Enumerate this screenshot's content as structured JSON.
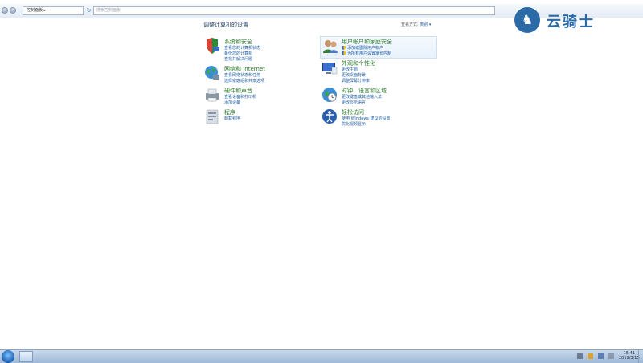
{
  "addressbar": {
    "path": "控制面板",
    "search_placeholder": "搜索控制面板"
  },
  "watermark": {
    "text": "云骑士"
  },
  "main": {
    "title": "调整计算机的设置",
    "view_by_label": "查看方式:",
    "view_by_value": "类别"
  },
  "categories_left": [
    {
      "title": "系统和安全",
      "links": [
        "查看您的计算机状态",
        "备份您的计算机",
        "查找并解决问题"
      ]
    },
    {
      "title": "网络和 Internet",
      "links": [
        "查看网络状态和任务",
        "选择家庭组和共享选项"
      ]
    },
    {
      "title": "硬件和声音",
      "links": [
        "查看设备和打印机",
        "添加设备"
      ]
    },
    {
      "title": "程序",
      "links": [
        "卸载程序"
      ]
    }
  ],
  "categories_right": [
    {
      "title": "用户帐户和家庭安全",
      "links": [
        "添加或删除用户帐户",
        "为所有用户设置家长控制"
      ]
    },
    {
      "title": "外观和个性化",
      "links": [
        "更改主题",
        "更改桌面背景",
        "调整屏幕分辨率"
      ]
    },
    {
      "title": "时钟、语言和区域",
      "links": [
        "更改键盘或其他输入法",
        "更改显示语言"
      ]
    },
    {
      "title": "轻松访问",
      "links": [
        "使用 Windows 建议的设置",
        "优化视频显示"
      ]
    }
  ],
  "taskbar": {
    "time": "15:41",
    "date": "2019/3/15"
  },
  "colors": {
    "category_title": "#2b7a2b",
    "link": "#1f5fa8",
    "taskbar": "#b3c9e2"
  }
}
